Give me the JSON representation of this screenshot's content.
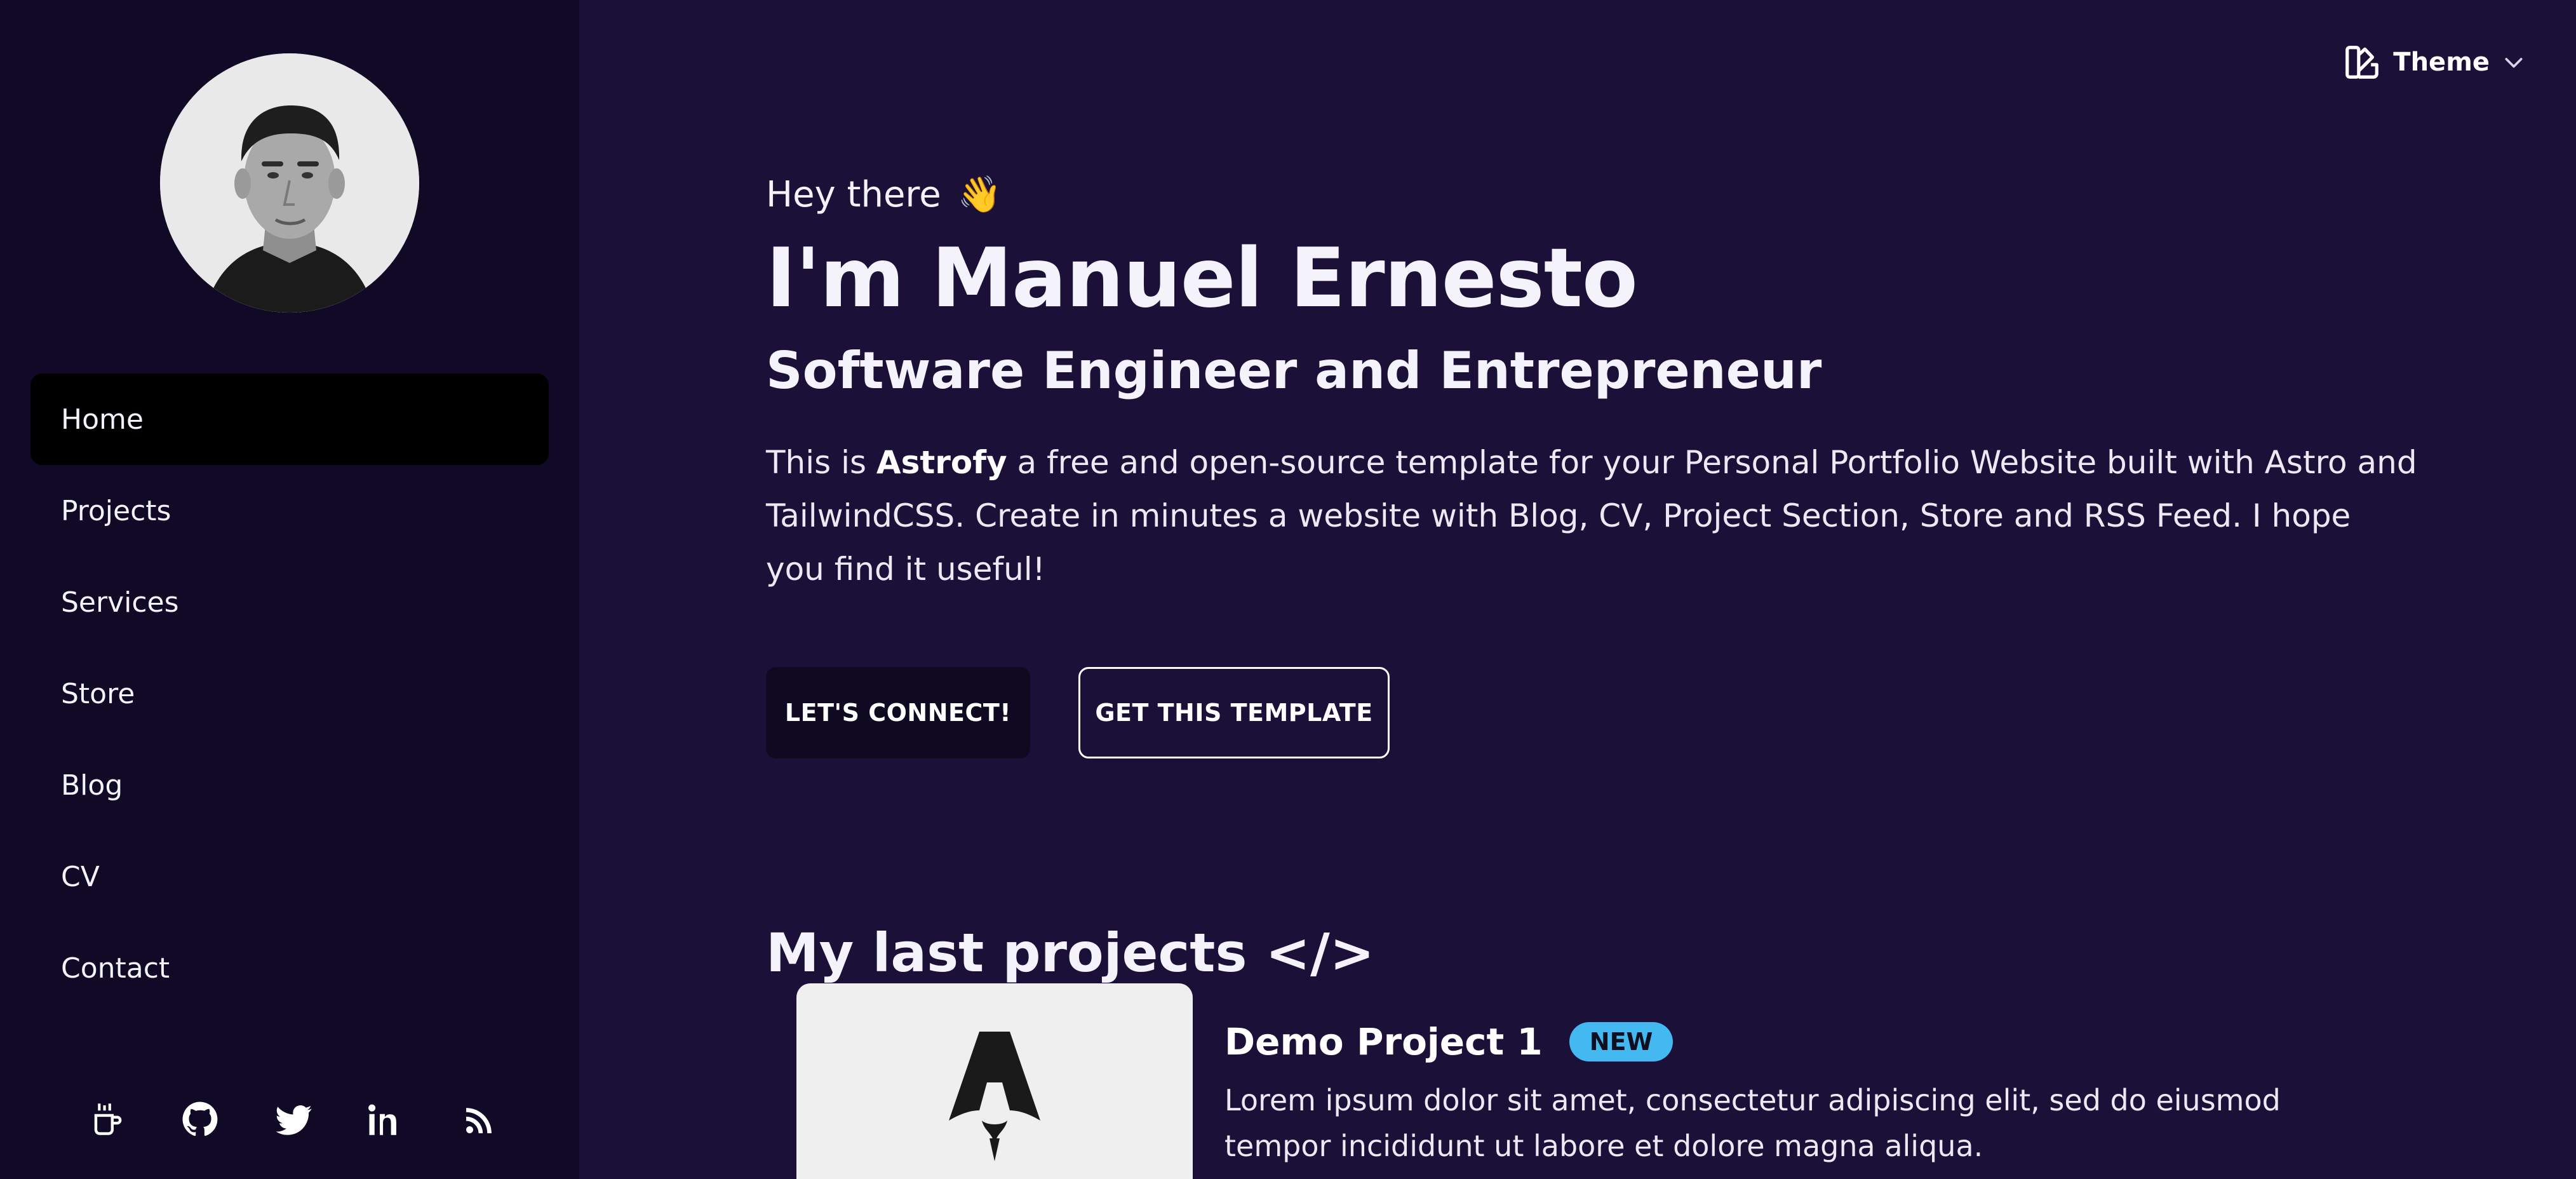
{
  "sidebar": {
    "nav": [
      {
        "label": "Home",
        "active": true
      },
      {
        "label": "Projects"
      },
      {
        "label": "Services"
      },
      {
        "label": "Store"
      },
      {
        "label": "Blog"
      },
      {
        "label": "CV"
      },
      {
        "label": "Contact"
      }
    ],
    "socials": [
      "coffee-icon",
      "github-icon",
      "twitter-icon",
      "linkedin-icon",
      "rss-icon"
    ]
  },
  "header": {
    "theme_label": "Theme"
  },
  "hero": {
    "greeting": "Hey there",
    "wave_emoji": "👋",
    "name": "I'm Manuel Ernesto",
    "role": "Software Engineer and Entrepreneur",
    "intro_prefix": "This is ",
    "intro_brand": "Astrofy",
    "intro_suffix": " a free and open-source template for your Personal Portfolio Website built with Astro and TailwindCSS. Create in minutes a website with Blog, CV, Project Section, Store and RSS Feed. I hope you find it useful!",
    "primary_button": "LET'S CONNECT!",
    "secondary_button": "GET THIS TEMPLATE"
  },
  "projects": {
    "section_title": "My last projects </>",
    "items": [
      {
        "title": "Demo Project 1",
        "badge": "NEW",
        "description": "Lorem ipsum dolor sit amet, consectetur adipiscing elit, sed do eiusmod tempor incididunt ut labore et dolore magna aliqua."
      }
    ]
  },
  "colors": {
    "sidebar_bg": "#110a27",
    "main_bg": "#1b1138",
    "active_nav_bg": "#000000",
    "badge_bg": "#44b8f0"
  }
}
